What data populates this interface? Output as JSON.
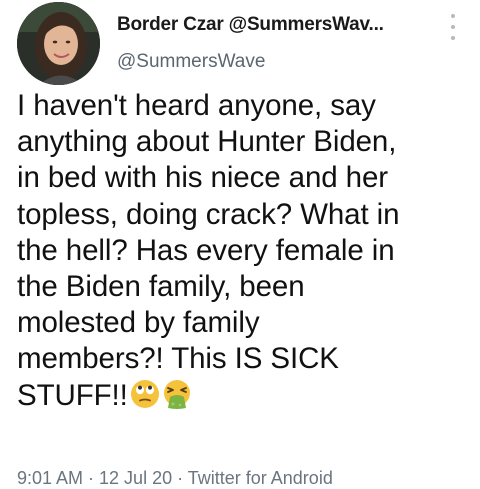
{
  "tweet": {
    "display_name": "Border Czar @SummersWav...",
    "handle": "@SummersWave",
    "lines": [
      "I haven't heard anyone, say",
      "anything about Hunter Biden,",
      "in bed with his niece and her",
      "topless, doing crack? What in",
      "the hell? Has every female in",
      "the Biden family, been",
      "molested by family",
      "members?! This IS SICK",
      "STUFF!!"
    ],
    "emojis": [
      "face-with-rolling-eyes-icon",
      "face-vomiting-icon"
    ],
    "meta": "9:01 AM · 12 Jul 20 · Twitter for Android"
  },
  "colors": {
    "text": "#111111",
    "secondary": "#5b6670",
    "emoji_yellow": "#f5c33b",
    "emoji_green": "#7cb342"
  }
}
